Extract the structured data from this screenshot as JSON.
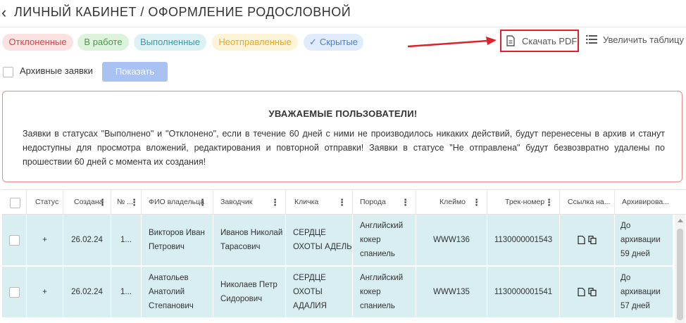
{
  "header": {
    "back_icon": "‹",
    "title": "ЛИЧНЫЙ КАБИНЕТ / ОФОРМЛЕНИЕ РОДОСЛОВНОЙ"
  },
  "chips": {
    "rejected": "Отклоненные",
    "in_work": "В работе",
    "done": "Выполненные",
    "not_sent": "Неотправленные",
    "hidden": "Скрытые",
    "hidden_check": "✓"
  },
  "toolbar": {
    "pdf_label": "Скачать PDF",
    "enlarge_label": "Увеличить таблицу"
  },
  "archive": {
    "label": "Архивные заявки",
    "show_button": "Показать"
  },
  "notice": {
    "title": "УВАЖАЕМЫЕ ПОЛЬЗОВАТЕЛИ!",
    "text": "Заявки в статусах \"Выполнено\" и \"Отклонено\", если в течение 60 дней с ними не производилось никаких действий, будут перенесены в архив и станут недоступны для просмотра вложений, редактирования и повторной отправки! Заявки в статусе \"Не отправлена\" будут безвозвратно удалены по прошествии 60 дней с момента их создания!"
  },
  "table": {
    "columns": [
      "Статус",
      "Создана",
      "№ ...",
      "ФИО владельца",
      "Заводчик",
      "Кличка",
      "Порода",
      "Клеймо",
      "Трек-номер",
      "Ссылка на...",
      "Архивирова..."
    ],
    "menu_glyph": "⋮",
    "rows": [
      {
        "status": "+",
        "created": "26.02.24",
        "num": "1...",
        "owner": "Викторов Иван Петрович",
        "breeder": "Иванов Николай Тарасович",
        "name": "СЕРДЦЕ ОХОТЫ АДЕЛЬ",
        "breed": "Английский кокер спаниель",
        "brand": "WWW136",
        "track": "1130000001543",
        "archive": "До архивации 59 дней"
      },
      {
        "status": "+",
        "created": "26.02.24",
        "num": "1...",
        "owner": "Анатольев Анатолий Степанович",
        "breeder": "Николаев Петр Сидорович",
        "name": "СЕРДЦЕ ОХОТЫ АДАЛИЯ",
        "breed": "Английский кокер спаниель",
        "brand": "WWW135",
        "track": "1130000001541",
        "archive": "До архивации 57 дней"
      }
    ]
  },
  "colors": {
    "accent_red": "#e0202a",
    "row_bg": "#d9eef0",
    "show_button": "#a9c2f1"
  }
}
